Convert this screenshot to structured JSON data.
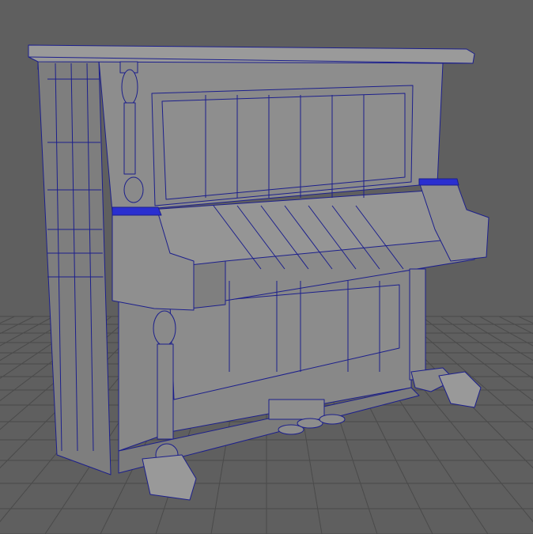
{
  "viewport": {
    "background": "#5f5f5f",
    "grid_color": "#4a4a4a",
    "mesh_fill": "#8b8b8b",
    "mesh_fill_dark": "#7a7a7a",
    "mesh_fill_light": "#9a9a9a",
    "wire_color": "#1c1f8c",
    "selection_color": "#2a2fd0",
    "object": "upright-piano-wireframe"
  }
}
